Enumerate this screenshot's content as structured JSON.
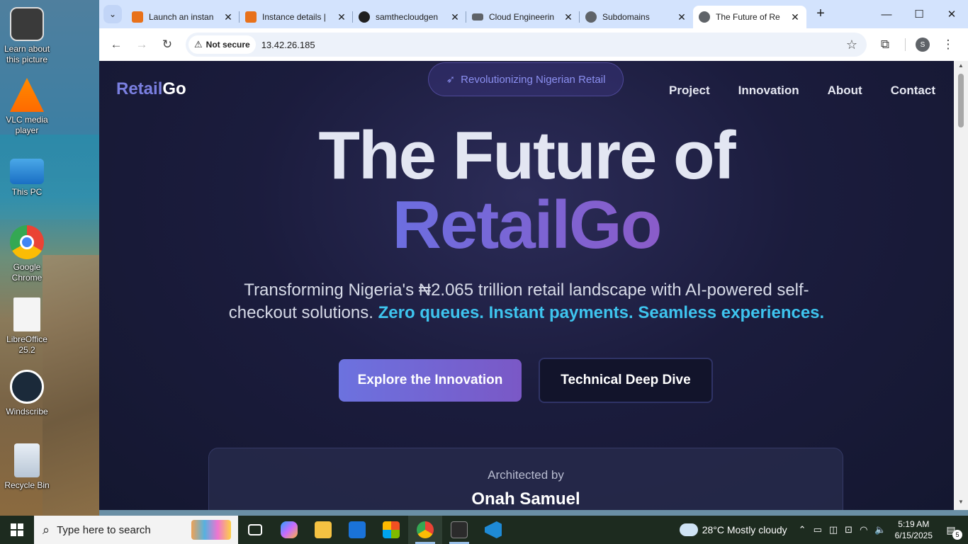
{
  "desktop": {
    "icons": [
      {
        "label": "Learn about this picture",
        "icon": "info-camera-icon"
      },
      {
        "label": "VLC media player",
        "icon": "vlc-icon"
      },
      {
        "label": "This PC",
        "icon": "computer-icon"
      },
      {
        "label": "Google Chrome",
        "icon": "chrome-icon"
      },
      {
        "label": "LibreOffice 25.2",
        "icon": "document-icon"
      },
      {
        "label": "Windscribe",
        "icon": "windscribe-icon"
      },
      {
        "label": "Recycle Bin",
        "icon": "recycle-bin-icon"
      }
    ]
  },
  "browser": {
    "tabs": [
      {
        "title": "Launch an instan",
        "icon": "aws-icon",
        "color": "#e8711a"
      },
      {
        "title": "Instance details |",
        "icon": "aws-icon",
        "color": "#e8711a"
      },
      {
        "title": "samthecloudgen",
        "icon": "github-icon",
        "color": "#1f1f1f"
      },
      {
        "title": "Cloud Engineerin",
        "icon": "document-icon",
        "color": "#5f6368"
      },
      {
        "title": "Subdomains",
        "icon": "globe-icon",
        "color": "#5f6368"
      },
      {
        "title": "The Future of Re",
        "icon": "globe-icon",
        "color": "#5f6368"
      }
    ],
    "security_label": "Not secure",
    "url": "13.42.26.185",
    "profile_initial": "S"
  },
  "page": {
    "logo_part1": "Retail",
    "logo_part2": "Go",
    "pill_text": "Revolutionizing Nigerian Retail",
    "nav": [
      "Project",
      "Innovation",
      "About",
      "Contact"
    ],
    "hero_line1": "The Future of",
    "hero_line2": "RetailGo",
    "subtitle_plain": "Transforming Nigeria's ₦2.065 trillion retail landscape with AI-powered self-checkout solutions.",
    "subtitle_highlight": "Zero queues. Instant payments. Seamless experiences.",
    "primary_button": "Explore the Innovation",
    "secondary_button": "Technical Deep Dive",
    "card_label": "Architected by",
    "card_name": "Onah Samuel",
    "colors": {
      "accent": "#6c72df",
      "highlight": "#3ec4ee",
      "background": "#1b1c3d"
    }
  },
  "taskbar": {
    "search_placeholder": "Type here to search",
    "weather": "28°C  Mostly cloudy",
    "time": "5:19 AM",
    "date": "6/15/2025",
    "notification_count": "5"
  }
}
